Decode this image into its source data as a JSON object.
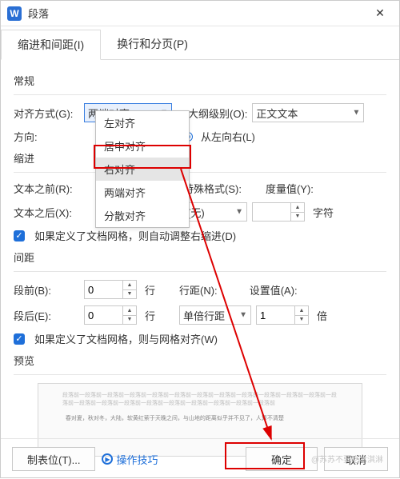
{
  "window": {
    "icon": "W",
    "title": "段落",
    "close": "✕"
  },
  "tabs": {
    "active": "缩进和间距(I)",
    "inactive": "换行和分页(P)"
  },
  "general": {
    "header": "常规",
    "align_label": "对齐方式(G):",
    "align_value": "两端对齐",
    "outline_label": "大纲级别(O):",
    "outline_value": "正文文本",
    "direction_label": "方向:",
    "direction_value": "从左向右(L)"
  },
  "dropdown": {
    "items": [
      "左对齐",
      "居中对齐",
      "右对齐",
      "两端对齐",
      "分散对齐"
    ],
    "highlight": "右对齐"
  },
  "indent": {
    "header": "缩进",
    "before_label": "文本之前(R):",
    "after_label": "文本之后(X):",
    "special_label": "特殊格式(S):",
    "special_value": "(无)",
    "measure_label": "度量值(Y):",
    "measure_unit": "字符",
    "grid_check": "如果定义了文档网格，则自动调整右缩进(D)"
  },
  "spacing": {
    "header": "间距",
    "before_label": "段前(B):",
    "before_value": "0",
    "after_label": "段后(E):",
    "after_value": "0",
    "line_unit": "行",
    "linespace_label": "行距(N):",
    "linespace_value": "单倍行距",
    "setval_label": "设置值(A):",
    "setval_value": "1",
    "setval_unit": "倍",
    "grid_check": "如果定义了文档网格，则与网格对齐(W)"
  },
  "preview": {
    "header": "预览"
  },
  "footer": {
    "tabs_btn": "制表位(T)...",
    "tips": "操作技巧",
    "ok": "确定",
    "cancel": "取消"
  },
  "watermark": "@苏苏不要吃冰淇淋"
}
